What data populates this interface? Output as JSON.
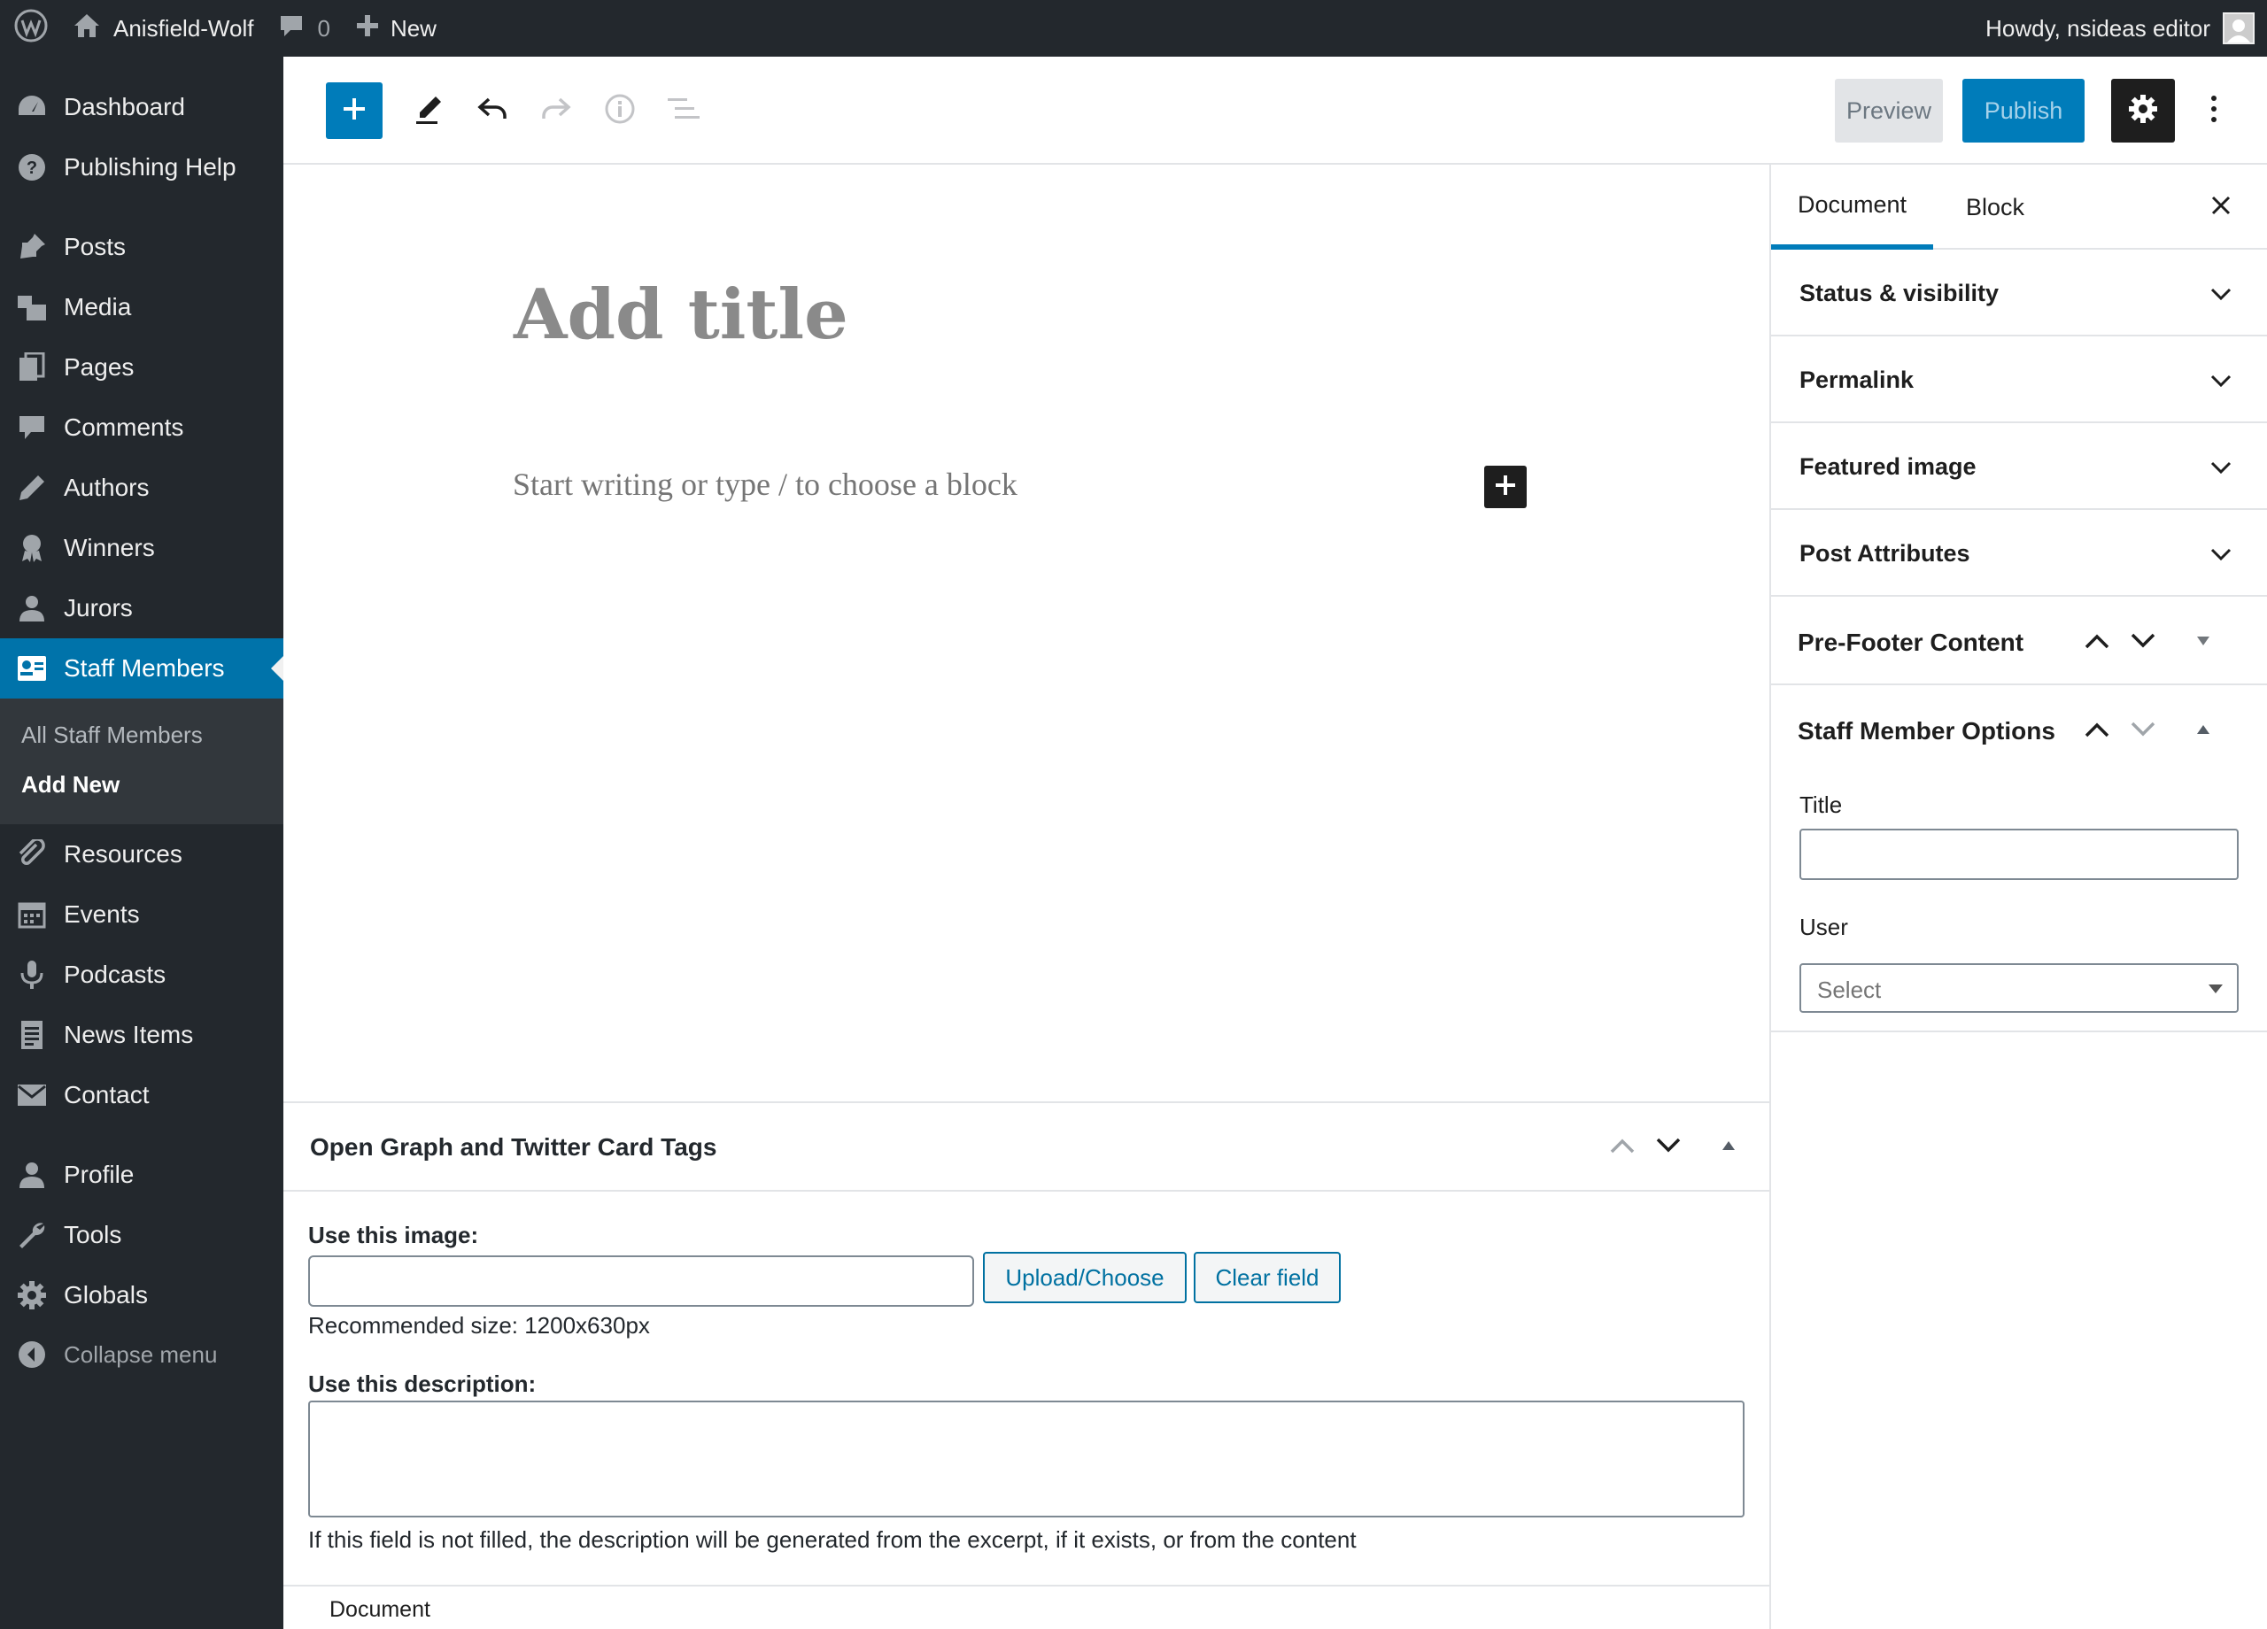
{
  "admin_bar": {
    "site_name": "Anisfield-Wolf",
    "comments_count": "0",
    "new_label": "New",
    "howdy": "Howdy, nsideas editor"
  },
  "sidebar": {
    "items": [
      {
        "label": "Dashboard",
        "icon": "dashboard-icon"
      },
      {
        "label": "Publishing Help",
        "icon": "help-icon"
      },
      {
        "label": "Posts",
        "icon": "pin-icon"
      },
      {
        "label": "Media",
        "icon": "media-icon"
      },
      {
        "label": "Pages",
        "icon": "pages-icon"
      },
      {
        "label": "Comments",
        "icon": "comment-icon"
      },
      {
        "label": "Authors",
        "icon": "pencil-icon"
      },
      {
        "label": "Winners",
        "icon": "award-icon"
      },
      {
        "label": "Jurors",
        "icon": "person-icon"
      },
      {
        "label": "Staff Members",
        "icon": "id-card-icon"
      },
      {
        "label": "Resources",
        "icon": "paperclip-icon"
      },
      {
        "label": "Events",
        "icon": "calendar-icon"
      },
      {
        "label": "Podcasts",
        "icon": "microphone-icon"
      },
      {
        "label": "News Items",
        "icon": "document-icon"
      },
      {
        "label": "Contact",
        "icon": "envelope-icon"
      },
      {
        "label": "Profile",
        "icon": "person-icon"
      },
      {
        "label": "Tools",
        "icon": "wrench-icon"
      },
      {
        "label": "Globals",
        "icon": "gear-icon"
      }
    ],
    "submenu": [
      "All Staff Members",
      "Add New"
    ],
    "collapse_label": "Collapse menu"
  },
  "toolbar": {
    "preview_label": "Preview",
    "publish_label": "Publish"
  },
  "editor": {
    "title_placeholder": "Add title",
    "block_placeholder": "Start writing or type / to choose a block"
  },
  "settings_sidebar": {
    "tabs": [
      "Document",
      "Block"
    ],
    "panels": [
      "Status & visibility",
      "Permalink",
      "Featured image",
      "Post Attributes"
    ],
    "prefooter_label": "Pre-Footer Content",
    "staff_options_label": "Staff Member Options",
    "title_field_label": "Title",
    "user_field_label": "User",
    "user_select_value": "Select"
  },
  "metabox": {
    "title": "Open Graph and Twitter Card Tags",
    "image_label": "Use this image:",
    "upload_button": "Upload/Choose",
    "clear_button": "Clear field",
    "recommended_size": "Recommended size: 1200x630px",
    "description_label": "Use this description:",
    "description_help": "If this field is not filled, the description will be generated from the excerpt, if it exists, or from the content"
  },
  "footer": {
    "breadcrumb": "Document"
  },
  "colors": {
    "admin_dark": "#23282d",
    "accent_blue": "#007cba",
    "current_menu": "#0073aa"
  }
}
